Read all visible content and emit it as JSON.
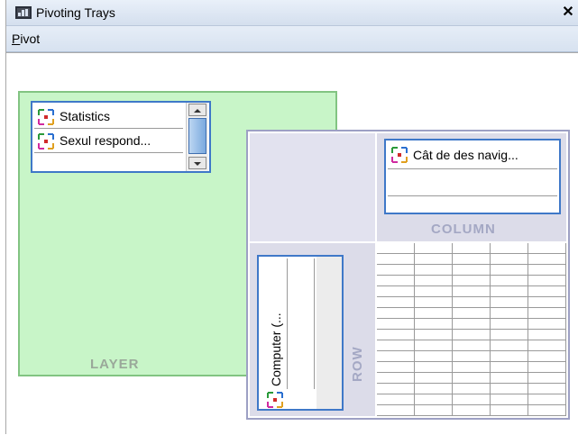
{
  "window": {
    "title": "Pivoting Trays",
    "close_label": "✕"
  },
  "menu": {
    "pivot_label_underlined": "P",
    "pivot_label_rest": "ivot"
  },
  "layer": {
    "label": "LAYER",
    "items": [
      {
        "label": "Statistics"
      },
      {
        "label": "Sexul respond..."
      }
    ]
  },
  "column": {
    "label": "COLUMN",
    "items": [
      {
        "label": "Cât de des navig..."
      }
    ]
  },
  "row": {
    "label": "ROW",
    "items": [
      {
        "label": "Computer (..."
      }
    ]
  },
  "icons": {
    "dimension_icon": "pivot-dimension-icon",
    "app_icon": "app-icon"
  },
  "colors": {
    "layer_bg": "#c8f5c8",
    "tray_bg": "#dcdce9",
    "list_border": "#3f78c8",
    "titlebar": "#dbe5f2"
  }
}
